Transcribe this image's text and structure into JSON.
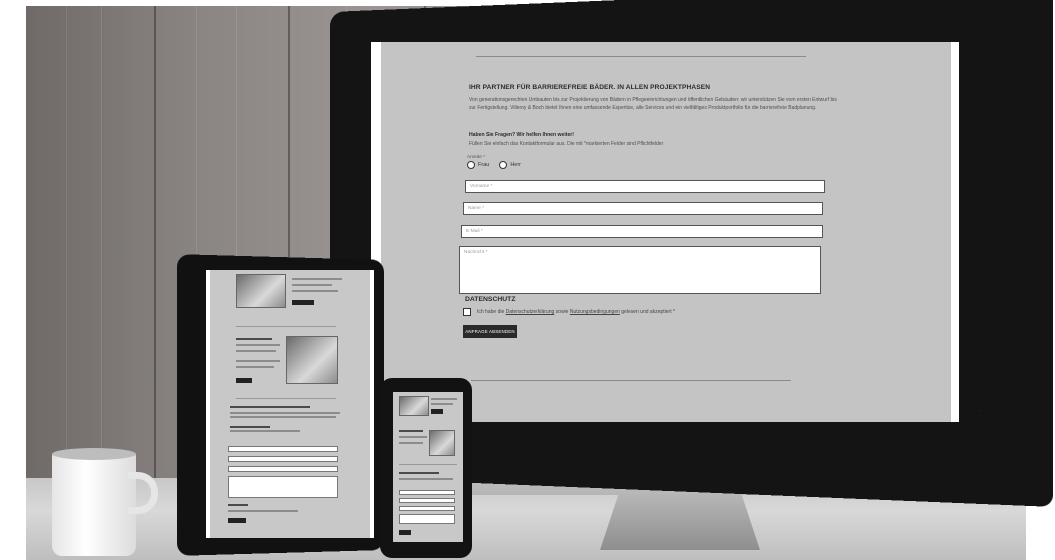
{
  "monitor": {
    "headline": "IHR PARTNER FÜR BARRIEREFREIE BÄDER. IN ALLEN PROJEKTPHASEN",
    "intro": "Von generationsgerechten Umbauten bis zur Projektierung von Bädern in Pflegeeinrichtungen und öffentlichen Gebäuden: wir unterstützen Sie vom ersten Entwurf bis zur Fertigstellung. Villeroy & Boch bietet Ihnen eine umfassende Expertise, alle Services und ein vielfältiges Produktportfolio für die barrierefreie Badplanung.",
    "question": "Haben Sie Fragen? Wir helfen Ihnen weiter!",
    "sub": "Füllen Sie einfach das Kontaktformular aus. Die mit *markierten Felder sind Pflichtfelder",
    "salutation_label": "Anrede *",
    "radio_options": [
      "Frau",
      "Herr"
    ],
    "fields": {
      "firstname_placeholder": "Vorname *",
      "lastname_placeholder": "Name *",
      "email_placeholder": "E-Mail *",
      "message_placeholder": "Nachricht *"
    },
    "privacy_title": "DATENSCHUTZ",
    "consent": {
      "prefix": "Ich habe die ",
      "link1": "Datenschutzerklärung",
      "middle": " sowie ",
      "link2": "Nutzungsbedingungen",
      "suffix": " gelesen und akzeptiert *"
    },
    "submit_label": "ANFRAGE ABSENDEN"
  }
}
